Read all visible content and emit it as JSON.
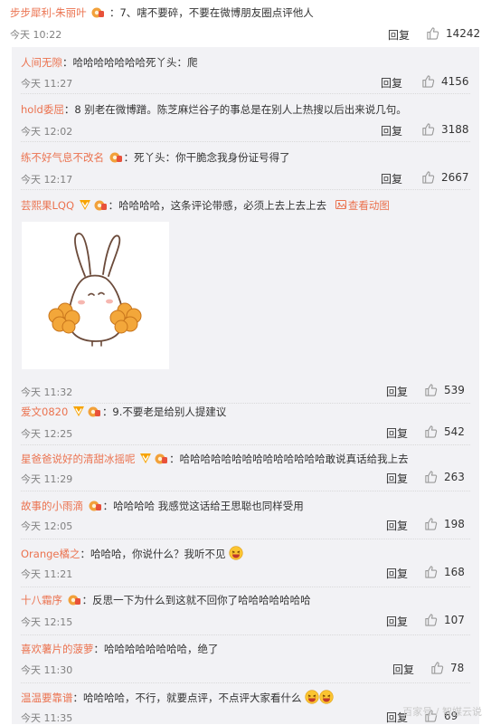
{
  "main_comment": {
    "username": "步步犀利-朱丽叶",
    "content": "：7、嗐不要碎，不要在微博朋友圈点评他人",
    "time": "今天 10:22",
    "reply_label": "回复",
    "likes": "14242"
  },
  "replies": [
    {
      "username": "人间无隙",
      "content": "：哈哈哈哈哈哈哈死丫头：爬",
      "time": "今天 11:27",
      "reply_label": "回复",
      "likes": "4156"
    },
    {
      "username": "hold委屈",
      "content": "：8  别老在微博蹭。陈芝麻烂谷子的事总是在别人上热搜以后出来说几句。",
      "time": "今天 12:02",
      "reply_label": "回复",
      "likes": "3188"
    },
    {
      "username": "练不好气息不改名",
      "content": "：死丫头：你干脆念我身份证号得了",
      "time": "今天 12:17",
      "reply_label": "回复",
      "likes": "2667"
    },
    {
      "username": "芸熙果LQQ",
      "content": "：哈哈哈哈，这条评论带感，必须上去上去上去",
      "view_anim": "查看动图",
      "time": "今天 11:32",
      "reply_label": "回复",
      "likes": "539"
    },
    {
      "username": "爱文0820",
      "content": "：9.不要老是给别人提建议",
      "time": "今天 12:25",
      "reply_label": "回复",
      "likes": "542"
    },
    {
      "username": "星爸爸说好的清甜冰摇呢",
      "content": "：哈哈哈哈哈哈哈哈哈哈哈哈哈哈敢说真话给我上去",
      "time": "今天 11:29",
      "reply_label": "回复",
      "likes": "263"
    },
    {
      "username": "故事的小雨滴",
      "content": "：哈哈哈哈  我感觉这话给王思聪也同样受用",
      "time": "今天 12:05",
      "reply_label": "回复",
      "likes": "198"
    },
    {
      "username": "Orange橘之",
      "content": "：哈哈哈，你说什么？我听不见",
      "time": "今天 11:21",
      "reply_label": "回复",
      "likes": "168"
    },
    {
      "username": "十八霜序",
      "content": "：反思一下为什么到这就不回你了哈哈哈哈哈哈哈",
      "time": "今天 12:15",
      "reply_label": "回复",
      "likes": "107"
    },
    {
      "username": "喜欢薯片的菠萝",
      "content": "：哈哈哈哈哈哈哈哈，绝了",
      "time": "今天 11:30",
      "reply_label": "回复",
      "likes": "78"
    },
    {
      "username": "温温要靠谱",
      "content": "：哈哈哈哈，不行，就要点评，不点评大家看什么",
      "time": "今天 11:35",
      "reply_label": "回复",
      "likes": "69"
    }
  ],
  "watermark": "百家号 / 智媒云说",
  "colors": {
    "username": "#eb7350",
    "text": "#333333",
    "meta": "#808080",
    "reply_bg": "#f2f2f5",
    "vip_badge": "#f7a400",
    "medal": "#f2a13a"
  },
  "icons": {
    "like": "thumbs-up-icon",
    "vip": "vip-badge-icon",
    "medal": "fan-medal-icon",
    "emoji": "laughing-emoji-icon",
    "anim": "view-animation-icon",
    "sticker": "bunny-cheerleader-sticker"
  }
}
